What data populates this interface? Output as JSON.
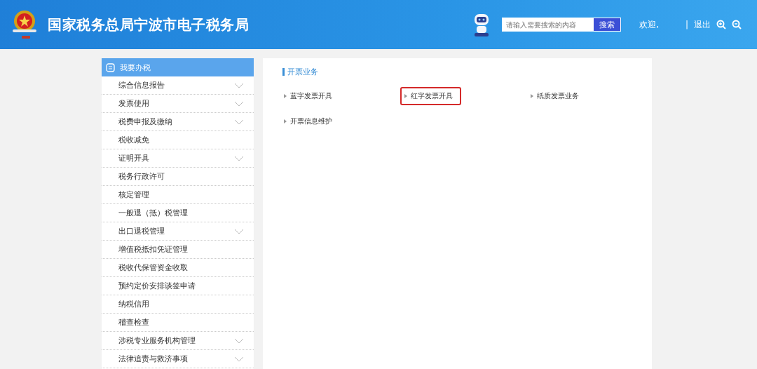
{
  "header": {
    "title": "国家税务总局宁波市电子税务局",
    "search": {
      "placeholder": "请输入需要搜索的内容",
      "button": "搜索"
    },
    "welcome": "欢迎,",
    "separator": "|",
    "logout": "退出"
  },
  "sidebar": {
    "title": "我要办税",
    "items": [
      {
        "label": "综合信息报告",
        "expandable": true
      },
      {
        "label": "发票使用",
        "expandable": true
      },
      {
        "label": "税费申报及缴纳",
        "expandable": true
      },
      {
        "label": "税收减免",
        "expandable": false
      },
      {
        "label": "证明开具",
        "expandable": true
      },
      {
        "label": "税务行政许可",
        "expandable": false
      },
      {
        "label": "核定管理",
        "expandable": false
      },
      {
        "label": "一般退（抵）税管理",
        "expandable": false
      },
      {
        "label": "出口退税管理",
        "expandable": true
      },
      {
        "label": "增值税抵扣凭证管理",
        "expandable": false
      },
      {
        "label": "税收代保管资金收取",
        "expandable": false
      },
      {
        "label": "预约定价安排谈签申请",
        "expandable": false
      },
      {
        "label": "纳税信用",
        "expandable": false
      },
      {
        "label": "稽查检查",
        "expandable": false
      },
      {
        "label": "涉税专业服务机构管理",
        "expandable": true
      },
      {
        "label": "法律追责与救济事项",
        "expandable": true
      }
    ]
  },
  "section": {
    "title": "开票业务",
    "links": [
      {
        "label": "蓝字发票开具",
        "highlighted": false
      },
      {
        "label": "红字发票开具",
        "highlighted": true
      },
      {
        "label": "纸质发票业务",
        "highlighted": false
      },
      {
        "label": "开票信息维护",
        "highlighted": false
      }
    ]
  }
}
